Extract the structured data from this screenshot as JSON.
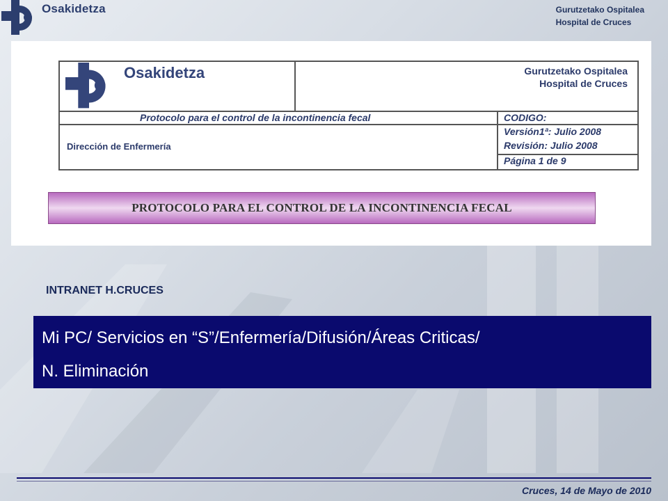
{
  "header": {
    "logo_text": "Osakidetza",
    "hospital_line1": "Gurutzetako Ospitalea",
    "hospital_line2": "Hospital de Cruces"
  },
  "document": {
    "logo_text": "Osakidetza",
    "hospital_line1": "Gurutzetako Ospitalea",
    "hospital_line2": "Hospital de Cruces",
    "protocol_row": "Protocolo para el control de la incontinencia fecal",
    "direccion": "Dirección de Enfermería",
    "codigo": "CODIGO:",
    "version": "Versión1ª: Julio 2008",
    "revision": "Revisión: Julio 2008",
    "pagina": "Página 1 de 9",
    "banner": "PROTOCOLO PARA EL CONTROL DE LA INCONTINENCIA FECAL"
  },
  "intranet_label": "INTRANET H.CRUCES",
  "path": {
    "line1": "Mi PC/ Servicios en “S”/Enfermería/Difusión/Áreas Criticas/",
    "line2": "N. Eliminación"
  },
  "footer": {
    "date": "Cruces, 14 de Mayo de 2010"
  },
  "colors": {
    "brand_navy": "#0a0a6e",
    "logo_blue": "#2c3e6e",
    "banner_purple": "#b86bbf"
  }
}
